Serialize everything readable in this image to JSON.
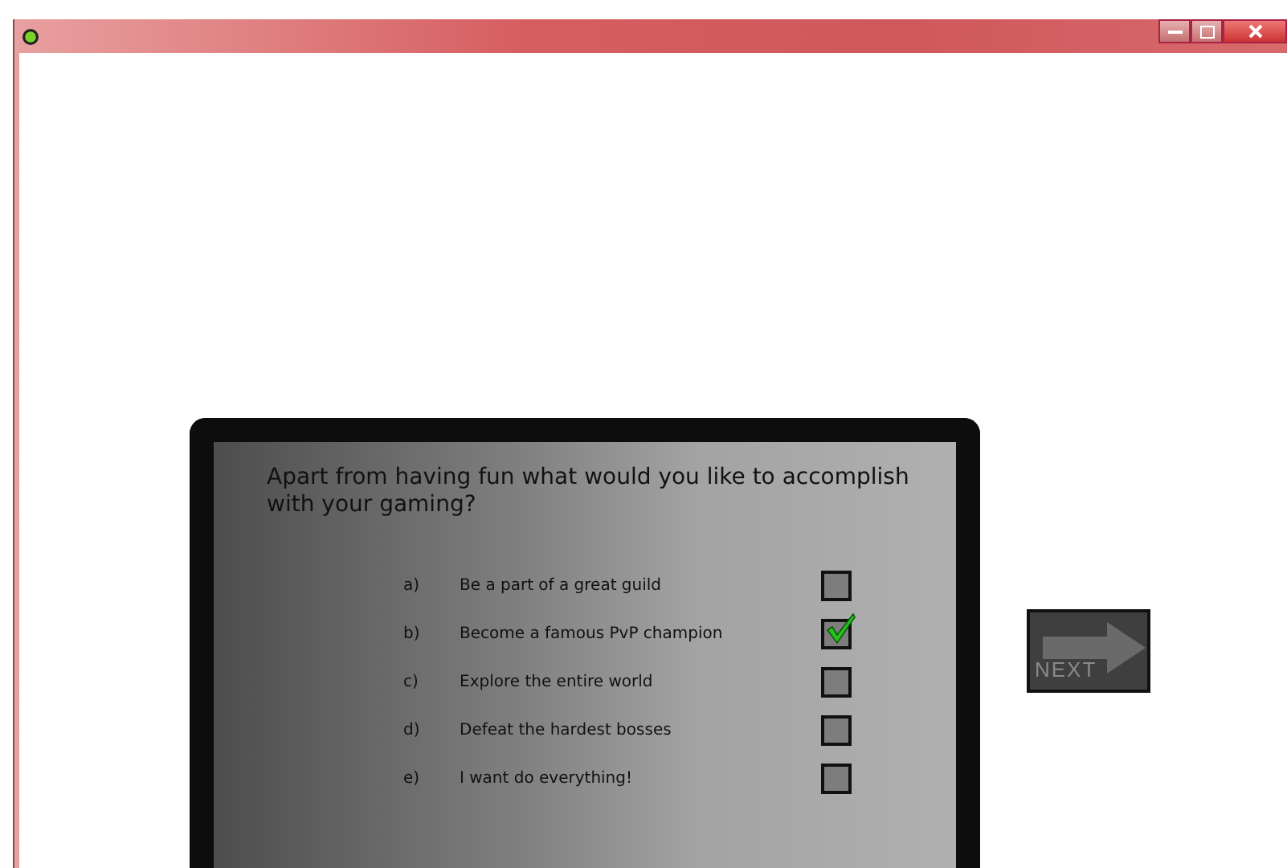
{
  "question": "Apart from having fun what would you like to  accomplish with your gaming?",
  "options": [
    {
      "letter": "a)",
      "text": "Be a part of a great guild",
      "checked": false
    },
    {
      "letter": "b)",
      "text": "Become a famous PvP champion",
      "checked": true
    },
    {
      "letter": "c)",
      "text": "Explore the entire world",
      "checked": false
    },
    {
      "letter": "d)",
      "text": "Defeat the hardest bosses",
      "checked": false
    },
    {
      "letter": "e)",
      "text": "I want do everything!",
      "checked": false
    }
  ],
  "next_button": {
    "label": "NEXT"
  }
}
